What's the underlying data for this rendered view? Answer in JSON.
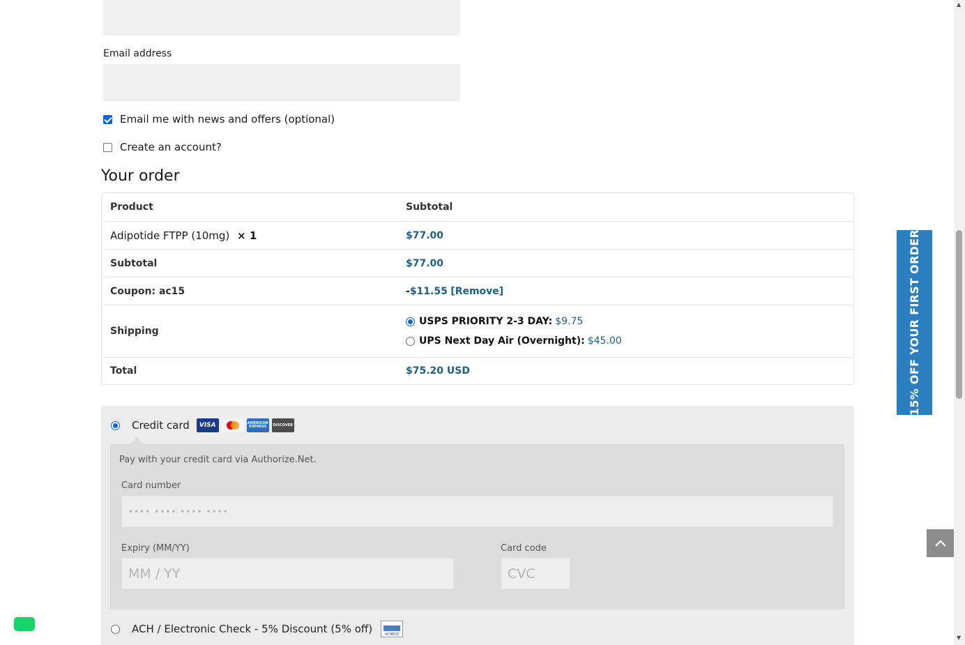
{
  "contact": {
    "email_label": "Email address",
    "newsletter_label": "Email me with news and offers (optional)",
    "newsletter_checked": true,
    "create_account_label": "Create an account?",
    "create_account_checked": false
  },
  "order": {
    "title": "Your order",
    "header_product": "Product",
    "header_subtotal": "Subtotal",
    "item_name": "Adipotide FTPP (10mg)",
    "item_qty": "× 1",
    "item_price": "$77.00",
    "subtotal_label": "Subtotal",
    "subtotal_value": "$77.00",
    "coupon_label": "Coupon: ac15",
    "coupon_sign": "-",
    "coupon_value": "$11.55",
    "coupon_remove": "[Remove]",
    "shipping_label": "Shipping",
    "shipping_options": [
      {
        "name": "USPS PRIORITY 2-3 DAY:",
        "price": "$9.75",
        "selected": true
      },
      {
        "name": "UPS Next Day Air (Overnight):",
        "price": "$45.00",
        "selected": false
      }
    ],
    "total_label": "Total",
    "total_value": "$75.20 USD"
  },
  "payment": {
    "credit_card_label": "Credit card",
    "credit_card_selected": true,
    "card_brands": [
      "VISA",
      "mastercard",
      "AMERICAN EXPRESS",
      "DISCOVER"
    ],
    "description": "Pay with your credit card via Authorize.Net.",
    "card_number_label": "Card number",
    "card_number_placeholder": "•••• •••• •••• ••••",
    "expiry_label": "Expiry (MM/YY)",
    "expiry_placeholder": "MM / YY",
    "card_code_label": "Card code",
    "card_code_placeholder": "CVC",
    "ach_label": "ACH / Electronic Check - 5% Discount (5% off)",
    "ach_badge": "eCHECK"
  },
  "promo": {
    "text": "15% OFF YOUR FIRST ORDER",
    "color": "#2b7fc0"
  },
  "icons": {
    "back_to_top": "chevron-up-icon",
    "chat": "chat-icon"
  }
}
